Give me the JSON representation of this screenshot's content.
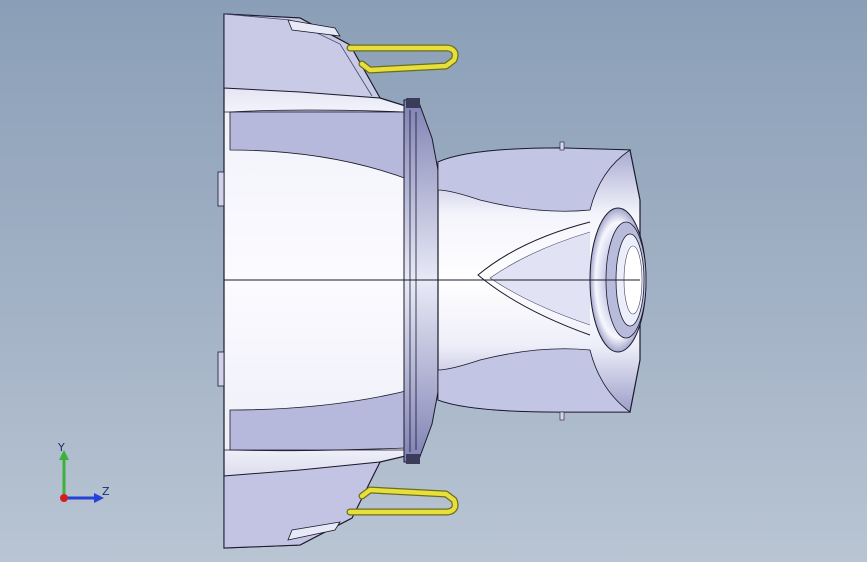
{
  "viewport": {
    "background_top": "#8a9fb7",
    "background_bottom": "#b9c5d3"
  },
  "model": {
    "body_color": "#dfe0f0",
    "shade_color": "#9a9cc2",
    "edge_color": "#1a1a2a",
    "handle_color": "#e8e03a",
    "handle_edge": "#6c6c20"
  },
  "triad": {
    "y_label": "Y",
    "z_label": "Z",
    "y_color": "#3bb23b",
    "z_color": "#2442d8",
    "x_color": "#d41e1e"
  }
}
